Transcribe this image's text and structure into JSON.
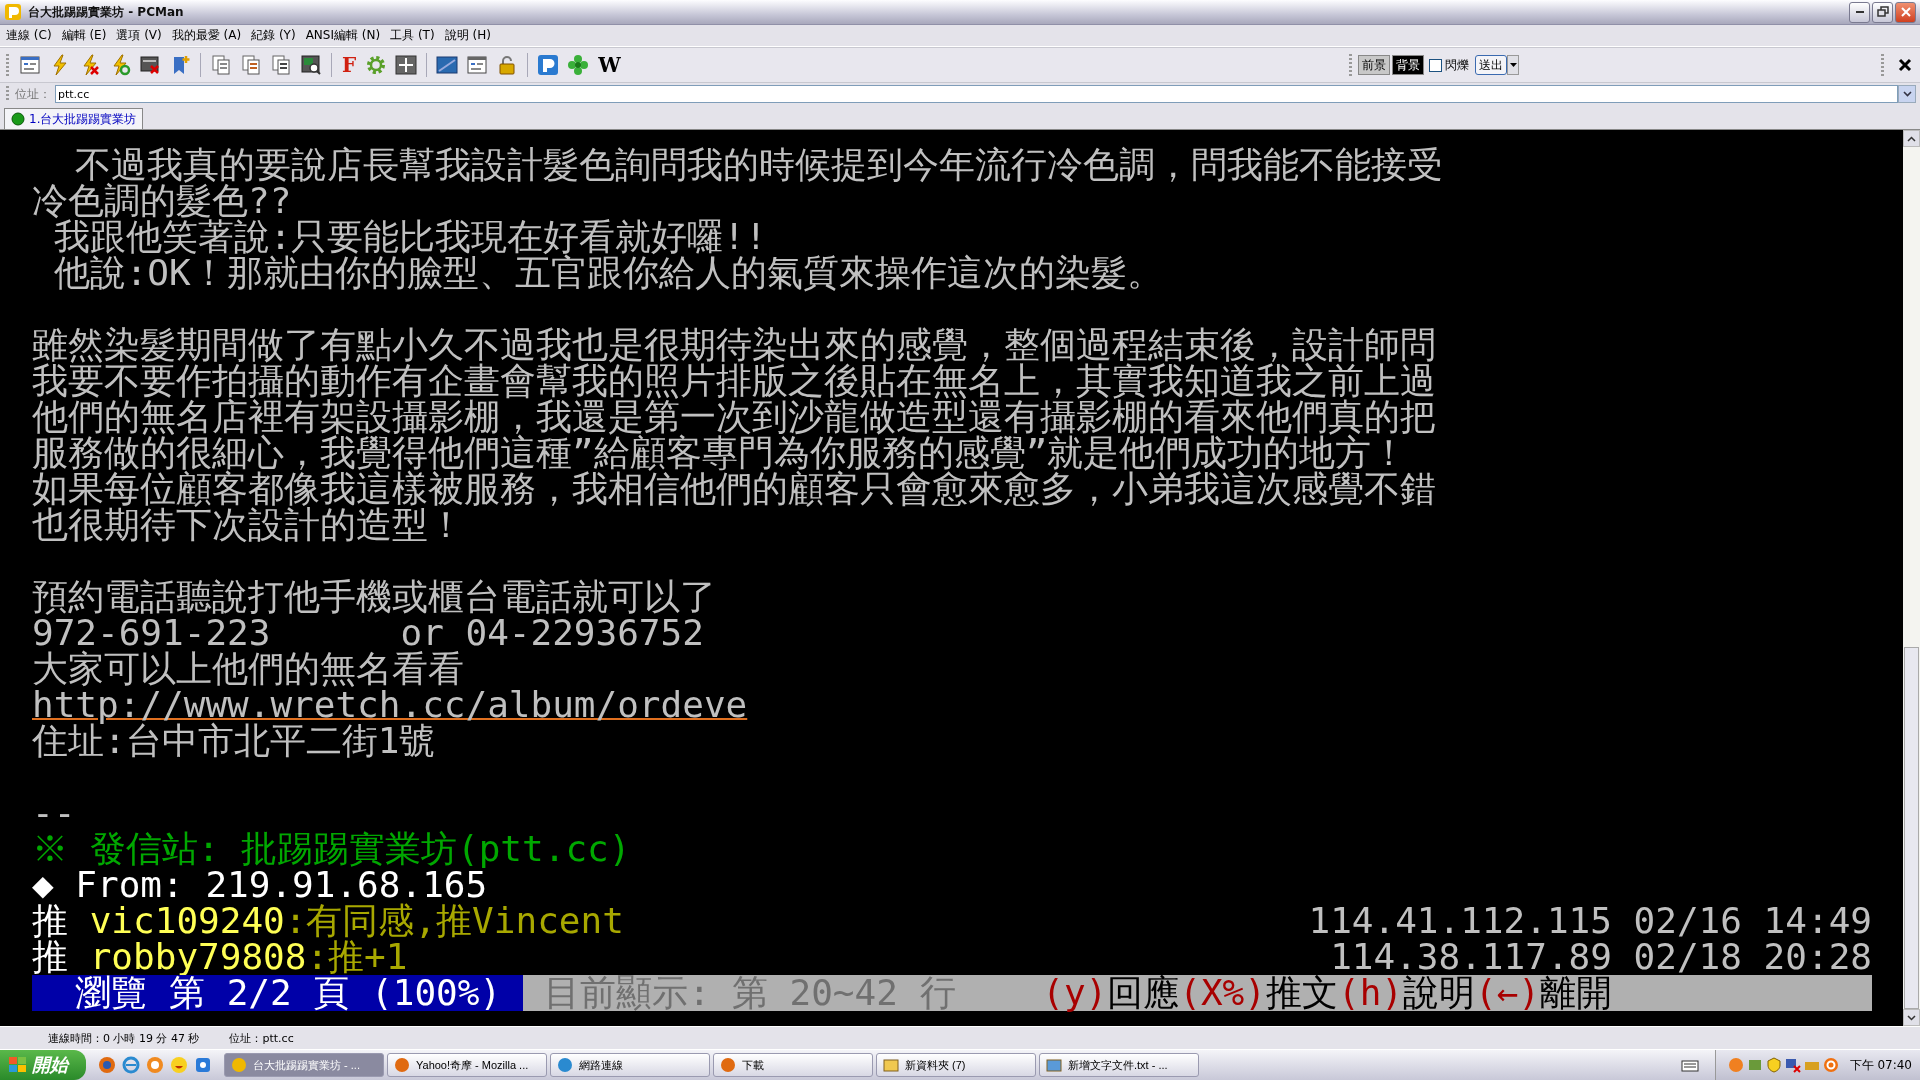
{
  "window": {
    "title": "台大批踢踢實業坊 - PCMan"
  },
  "menu": [
    "連線 (C)",
    "編輯 (E)",
    "選項 (V)",
    "我的最愛 (A)",
    "紀錄 (Y)",
    "ANSI編輯 (N)",
    "工具 (T)",
    "說明 (H)"
  ],
  "toolbar": {
    "items": [
      {
        "kind": "sites"
      },
      {
        "kind": "connect"
      },
      {
        "kind": "disconnect"
      },
      {
        "kind": "reconnect"
      },
      {
        "kind": "close-all"
      },
      {
        "kind": "favorite"
      },
      {
        "kind": "sep"
      },
      {
        "kind": "copy"
      },
      {
        "kind": "paste"
      },
      {
        "kind": "copy-paste"
      },
      {
        "kind": "find"
      },
      {
        "kind": "sep"
      },
      {
        "kind": "letter",
        "label": "F"
      },
      {
        "kind": "settings"
      },
      {
        "kind": "fullscreen"
      },
      {
        "kind": "sep"
      },
      {
        "kind": "window"
      },
      {
        "kind": "ansi"
      },
      {
        "kind": "lock"
      },
      {
        "kind": "sep"
      },
      {
        "kind": "app"
      },
      {
        "kind": "plugin"
      },
      {
        "kind": "letter",
        "label": "W"
      }
    ],
    "color_buttons": [
      {
        "label": "前景",
        "selected": false
      },
      {
        "label": "背景",
        "selected": true
      }
    ],
    "blink": {
      "label": "閃爍",
      "checked": false
    },
    "send": {
      "label": "送出"
    }
  },
  "address": {
    "label": "位址：",
    "value": "ptt.cc"
  },
  "tabs": [
    {
      "label": "1.台大批踢踢實業坊",
      "selected": true
    }
  ],
  "terminal": {
    "rows": [
      {
        "kind": "text",
        "segments": [
          {
            "text": "  不過我真的要說店長幫我設計髮色詢問我的時候提到今年流行冷色調，問我能不能接受",
            "color": "#c0c0c0"
          }
        ]
      },
      {
        "kind": "text",
        "segments": [
          {
            "text": "冷色調的髮色??",
            "color": "#c0c0c0"
          }
        ]
      },
      {
        "kind": "text",
        "segments": [
          {
            "text": " 我跟他笑著說:只要能比我現在好看就好囉!!",
            "color": "#c0c0c0"
          }
        ]
      },
      {
        "kind": "text",
        "segments": [
          {
            "text": " 他說:OK！那就由你的臉型、五官跟你給人的氣質來操作這次的染髮。",
            "color": "#c0c0c0"
          }
        ]
      },
      {
        "kind": "blank"
      },
      {
        "kind": "text",
        "segments": [
          {
            "text": "雖然染髮期間做了有點小久不過我也是很期待染出來的感覺，整個過程結束後，設計師問",
            "color": "#c0c0c0"
          }
        ]
      },
      {
        "kind": "text",
        "segments": [
          {
            "text": "我要不要作拍攝的動作有企畫會幫我的照片排版之後貼在無名上，其實我知道我之前上過",
            "color": "#c0c0c0"
          }
        ]
      },
      {
        "kind": "text",
        "segments": [
          {
            "text": "他們的無名店裡有架設攝影棚，我還是第一次到沙龍做造型還有攝影棚的看來他們真的把",
            "color": "#c0c0c0"
          }
        ]
      },
      {
        "kind": "text",
        "segments": [
          {
            "text": "服務做的很細心，我覺得他們這種”給顧客專門為你服務的感覺”就是他們成功的地方！",
            "color": "#c0c0c0"
          }
        ]
      },
      {
        "kind": "text",
        "segments": [
          {
            "text": "如果每位顧客都像我這樣被服務，我相信他們的顧客只會愈來愈多，小弟我這次感覺不錯",
            "color": "#c0c0c0"
          }
        ]
      },
      {
        "kind": "text",
        "segments": [
          {
            "text": "也很期待下次設計的造型！",
            "color": "#c0c0c0"
          }
        ]
      },
      {
        "kind": "blank"
      },
      {
        "kind": "text",
        "segments": [
          {
            "text": "預約電話聽說打他手機或櫃台電話就可以了",
            "color": "#c0c0c0"
          }
        ]
      },
      {
        "kind": "text",
        "segments": [
          {
            "text": "972-691-223      or 04-22936752",
            "color": "#c0c0c0"
          }
        ]
      },
      {
        "kind": "text",
        "segments": [
          {
            "text": "大家可以上他們的無名看看",
            "color": "#c0c0c0"
          }
        ]
      },
      {
        "kind": "link",
        "segments": [
          {
            "text": "http://www.wretch.cc/album/ordeve",
            "color": "#c0c0c0"
          }
        ]
      },
      {
        "kind": "text",
        "segments": [
          {
            "text": "住址:台中市北平二街1號",
            "color": "#c0c0c0"
          }
        ]
      },
      {
        "kind": "blank"
      },
      {
        "kind": "text",
        "segments": [
          {
            "text": "--",
            "color": "#c0c0c0"
          }
        ]
      },
      {
        "kind": "text",
        "segments": [
          {
            "text": "※ 發信站: 批踢踢實業坊(ptt.cc)",
            "color": "#00a800"
          }
        ]
      },
      {
        "kind": "text",
        "segments": [
          {
            "text": "◆ From: 219.91.68.165",
            "color": "#ffffff"
          }
        ]
      },
      {
        "kind": "push",
        "segments": [
          {
            "text": "推 ",
            "color": "#ffffff"
          },
          {
            "text": "vic109240",
            "color": "#ffff55"
          },
          {
            "text": ":有同感,推Vincent",
            "color": "#a8a800"
          }
        ],
        "right": "114.41.112.115 02/16 14:49"
      },
      {
        "kind": "push",
        "segments": [
          {
            "text": "推 ",
            "color": "#ffffff"
          },
          {
            "text": "robby79808",
            "color": "#ffff55"
          },
          {
            "text": ":推+1",
            "color": "#a8a800"
          }
        ],
        "right": "114.38.117.89 02/18 20:28"
      },
      {
        "kind": "status",
        "panels": [
          {
            "kind": "page",
            "segments": [
              {
                "kind": "page",
                "text": "  瀏覽 第 2/2 頁 (100%) "
              }
            ]
          },
          {
            "kind": "info",
            "segments": [
              {
                "kind": "info",
                "text": " 目前顯示: 第 20~42 行  "
              },
              {
                "kind": "key",
                "text": "  (y)"
              },
              {
                "kind": "action",
                "text": "回應"
              },
              {
                "kind": "key",
                "text": "(X%)"
              },
              {
                "kind": "action",
                "text": "推文"
              },
              {
                "kind": "key",
                "text": "(h)"
              },
              {
                "kind": "action",
                "text": "說明"
              },
              {
                "kind": "key",
                "text": "(←)"
              },
              {
                "kind": "action",
                "text": "離開"
              }
            ]
          }
        ]
      }
    ]
  },
  "status_bar": [
    "連線時間：0 小時 19 分 47 秒",
    "位址：ptt.cc"
  ],
  "taskbar": {
    "start": "開始",
    "tasks": [
      {
        "kind": "pcman",
        "label": "台大批踢踢實業坊 - ...",
        "selected": true
      },
      {
        "kind": "firefox",
        "label": "Yahoo!奇摩 - Mozilla ...",
        "selected": false
      },
      {
        "kind": "network",
        "label": "網路連線",
        "selected": false
      },
      {
        "kind": "firefox",
        "label": "下載",
        "selected": false
      },
      {
        "kind": "folder",
        "label": "新資料夾 (7)",
        "selected": false
      },
      {
        "kind": "notepad",
        "label": "新增文字文件.txt - ...",
        "selected": false
      }
    ],
    "clock": "下午 07:40"
  }
}
